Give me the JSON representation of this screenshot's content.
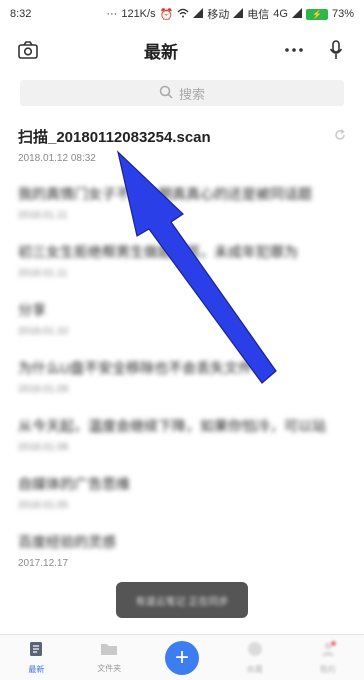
{
  "status_bar": {
    "time": "8:32",
    "speed": "121K/s",
    "carrier1": "移动",
    "carrier2": "电信",
    "network": "4G",
    "battery": "73%"
  },
  "header": {
    "title": "最新"
  },
  "search": {
    "placeholder": "搜索"
  },
  "documents": [
    {
      "title": "扫描_20180112083254.scan",
      "date": "2018.01.12 08:32"
    },
    {
      "title": "我的真情门女子不如一期真真心的还是被同话题",
      "date": "2018.01.11"
    },
    {
      "title": "初三女生拒绝帮男生做题被骂，未成年犯罪为",
      "date": "2018.01.11"
    },
    {
      "title": "分享",
      "date": "2018.01.10"
    },
    {
      "title": "为什么U盘不安全移除也不会丢失文件?",
      "date": "2018.01.09"
    },
    {
      "title": "从今天起，温度会继续下降，如果你怕冷，可以站",
      "date": "2018.01.08"
    },
    {
      "title": "自媒体的广告思维",
      "date": "2018.01.05"
    },
    {
      "title": "百度经验的灵感",
      "date": "2017.12.17"
    }
  ],
  "toast": {
    "text": "有道云笔记 正在同步"
  },
  "tabs": [
    {
      "label": "最新"
    },
    {
      "label": "文件夹"
    },
    {
      "label": "收藏"
    },
    {
      "label": "我的"
    }
  ],
  "colors": {
    "accent": "#3d7df2",
    "annotation_arrow": "#2a3fe8",
    "battery": "#2eb84b"
  }
}
